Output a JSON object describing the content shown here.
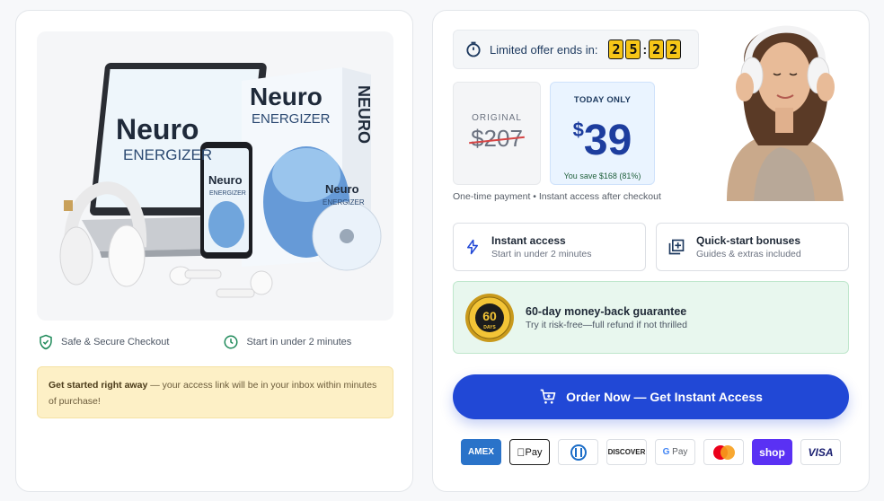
{
  "left": {
    "trust": [
      {
        "icon": "shield-check-icon",
        "label": "Safe & Secure Checkout"
      },
      {
        "icon": "clock-icon",
        "label": "Start in under 2 minutes"
      }
    ],
    "notice": {
      "bold": "Get started right away",
      "text": " — your access link will be in your inbox within minutes of purchase!"
    },
    "product": {
      "laptop_line1": "Neuro",
      "laptop_line2": "ENERGIZER",
      "box_line1": "Neuro",
      "box_line2": "ENERGIZER",
      "box_side": "NEURO",
      "phone_line1": "Neuro",
      "phone_line2": "ENERGIZER",
      "disc_line1": "Neuro",
      "disc_line2": "ENERGIZER"
    }
  },
  "right": {
    "timer": {
      "label": "Limited offer ends in:",
      "digits": [
        "2",
        "5",
        "2",
        "2"
      ]
    },
    "original": {
      "label": "ORIGINAL",
      "price": "$207"
    },
    "today": {
      "label": "TODAY ONLY",
      "currency": "$",
      "price": "39",
      "save": "You save $168 (81%)"
    },
    "payment_note": "One-time payment • Instant access after checkout",
    "features": [
      {
        "icon": "lightning-icon",
        "title": "Instant access",
        "sub": "Start in under 2 minutes"
      },
      {
        "icon": "add-library-icon",
        "title": "Quick-start bonuses",
        "sub": "Guides & extras included"
      }
    ],
    "guarantee": {
      "badge": "60",
      "badge_sub": "DAYS",
      "title": "60-day money-back guarantee",
      "sub": "Try it risk-free—full refund if not thrilled"
    },
    "order_button": "Order Now — Get Instant Access",
    "payments": [
      {
        "name": "amex",
        "label": "AMEX"
      },
      {
        "name": "apple-pay",
        "label": "Pay"
      },
      {
        "name": "diners",
        "label": ""
      },
      {
        "name": "discover",
        "label": "DISCOVER"
      },
      {
        "name": "google-pay",
        "label": "Pay"
      },
      {
        "name": "mastercard",
        "label": ""
      },
      {
        "name": "shop-pay",
        "label": "shop"
      },
      {
        "name": "visa",
        "label": "VISA"
      }
    ]
  },
  "colors": {
    "accent": "#2148d6",
    "timer_digit": "#f6c617",
    "guarantee_bg": "#e8f7ee",
    "notice_bg": "#fdf0c6"
  }
}
